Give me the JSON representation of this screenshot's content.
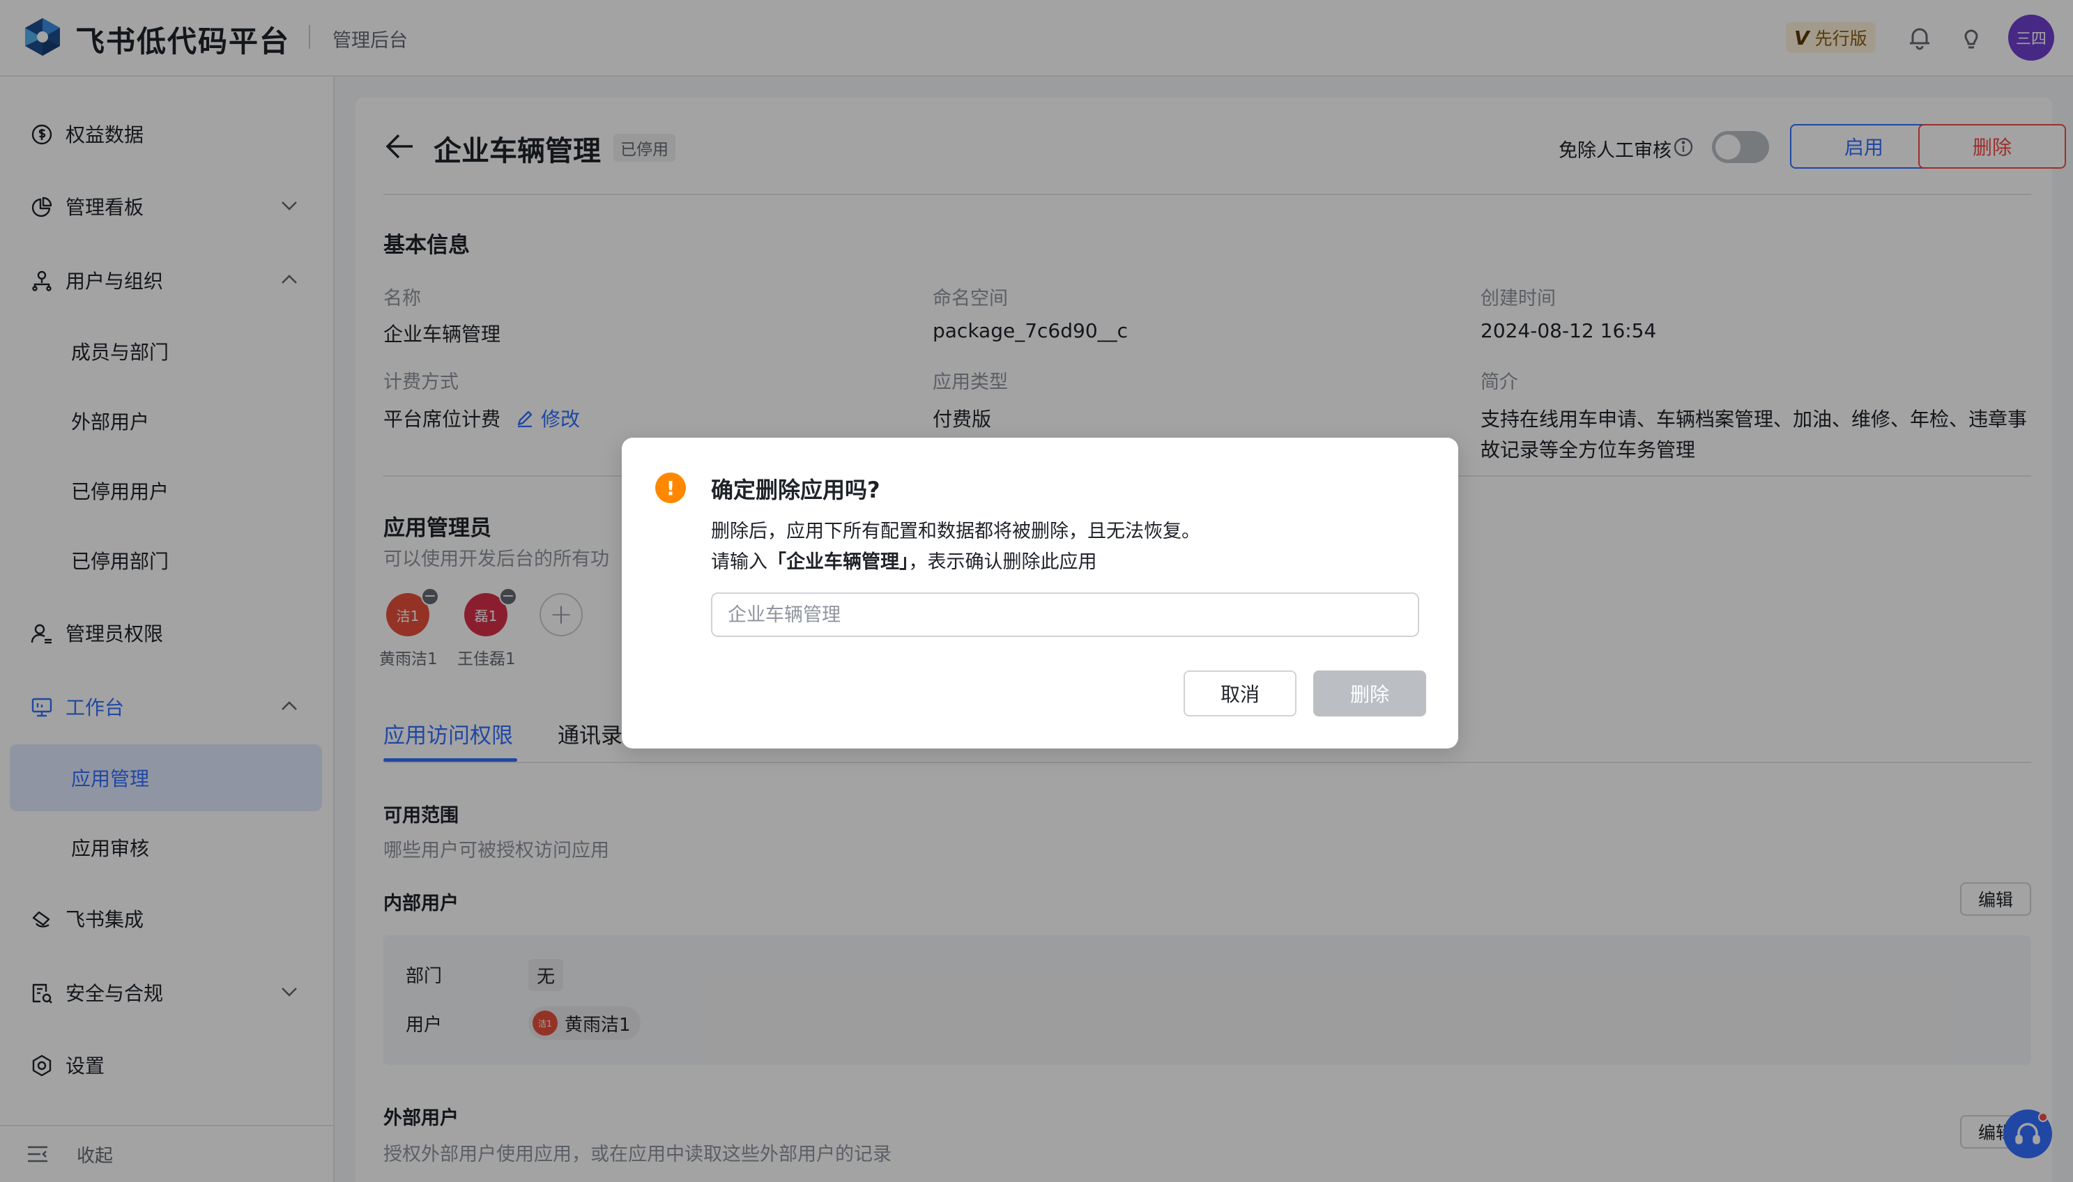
{
  "header": {
    "brand_name": "飞书低代码平台",
    "brand_sub": "管理后台",
    "edition_mark": "V",
    "edition_label": "先行版",
    "avatar_text": "三四"
  },
  "sidebar": {
    "items": [
      {
        "label": "权益数据",
        "icon": "dollar-circle-icon"
      },
      {
        "label": "管理看板",
        "icon": "pie-chart-icon"
      },
      {
        "label": "用户与组织",
        "icon": "org-icon"
      },
      {
        "label": "成员与部门"
      },
      {
        "label": "外部用户"
      },
      {
        "label": "已停用用户"
      },
      {
        "label": "已停用部门"
      },
      {
        "label": "管理员权限",
        "icon": "admin-user-icon"
      },
      {
        "label": "工作台",
        "icon": "monitor-icon"
      },
      {
        "label": "应用管理"
      },
      {
        "label": "应用审核"
      },
      {
        "label": "飞书集成",
        "icon": "integration-icon"
      },
      {
        "label": "安全与合规",
        "icon": "security-doc-icon"
      },
      {
        "label": "设置",
        "icon": "gear-icon"
      }
    ],
    "collapse_label": "收起"
  },
  "page": {
    "title": "企业车辆管理",
    "status_tag": "已停用",
    "auto_review_label": "免除人工审核",
    "auto_review_on": false,
    "enable_button": "启用",
    "delete_button": "删除"
  },
  "basic_info": {
    "section_title": "基本信息",
    "name_label": "名称",
    "name_value": "企业车辆管理",
    "namespace_label": "命名空间",
    "namespace_value": "package_7c6d90__c",
    "created_label": "创建时间",
    "created_value": "2024-08-12 16:54",
    "billing_label": "计费方式",
    "billing_value": "平台席位计费",
    "billing_edit": "修改",
    "type_label": "应用类型",
    "type_value": "付费版",
    "intro_label": "简介",
    "intro_line1": "支持在线用车申请、车辆档案管理、加油、维修、年检、违章事",
    "intro_line2": "故记录等全方位车务管理"
  },
  "admins": {
    "section_title": "应用管理员",
    "section_desc": "可以使用开发后台的所有功",
    "list": [
      {
        "avatar_text": "洁1",
        "name": "黄雨洁1",
        "color": "#e8503a"
      },
      {
        "avatar_text": "磊1",
        "name": "王佳磊1",
        "color": "#d8304a"
      }
    ]
  },
  "tabs": {
    "access": "应用访问权限",
    "contacts": "通讯录"
  },
  "scope": {
    "title": "可用范围",
    "desc": "哪些用户可被授权访问应用",
    "internal_title": "内部用户",
    "edit_label": "编辑",
    "dept_label": "部门",
    "dept_value": "无",
    "user_label": "用户",
    "user_avatar_text": "洁1",
    "user_value": "黄雨洁1",
    "external_title": "外部用户",
    "external_desc": "授权外部用户使用应用，或在应用中读取这些外部用户的记录",
    "external_edit_label": "编辑"
  },
  "modal": {
    "warn_glyph": "!",
    "title": "确定删除应用吗?",
    "desc_line1": "删除后，应用下所有配置和数据都将被删除，且无法恢复。",
    "desc_line2_prefix": "请输入",
    "desc_line2_bold": "「企业车辆管理」",
    "desc_line2_suffix": "，表示确认删除此应用",
    "input_placeholder": "企业车辆管理",
    "input_value": "",
    "cancel_label": "取消",
    "delete_label": "删除"
  },
  "colors": {
    "accent": "#3370ff",
    "danger": "#f54a45",
    "warning": "#ff8800"
  }
}
